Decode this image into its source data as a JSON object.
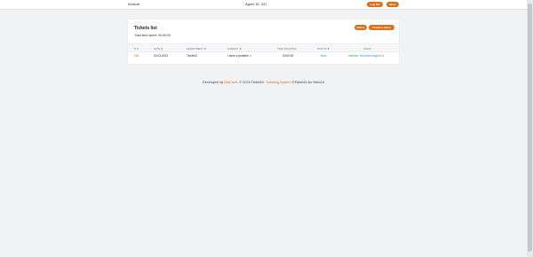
{
  "header": {
    "app_name": "Itobsoft",
    "agent_id": "Agent ID: 322",
    "logout_label": "Log Off",
    "more_label": "More"
  },
  "tickets": {
    "title": "Tickets list",
    "total_time": "Total time spent: 00:00:00",
    "filters_label": "Filters",
    "create_label": "Create a ticket",
    "columns": [
      "N.N.",
      "DATE ⬍",
      "DEPARTMENT ⬍",
      "SUBJECT ⬍",
      "TIME TRACKING",
      "STATUS ⬍",
      "TASKS"
    ],
    "rows": [
      {
        "id": "546",
        "date": "02.03.2023",
        "department": "Ticket24",
        "subject": "I have a problem",
        "time": "00:00:00",
        "status": "New",
        "task_priority": "medium",
        "task_name": "Technical support"
      }
    ]
  },
  "footer": {
    "prefix": "Developed by",
    "company": "OMCsoft",
    "middle": ". © 2023 Ticket24.",
    "system": "Ticketing System",
    "suffix": "©Ticket24 for Bitrix24"
  },
  "icons": {
    "edit": "pencil-icon",
    "external": "external-link-icon"
  },
  "colors": {
    "accent": "#d9711c",
    "status_new": "#3b8edb",
    "priority_medium": "#41a447"
  }
}
